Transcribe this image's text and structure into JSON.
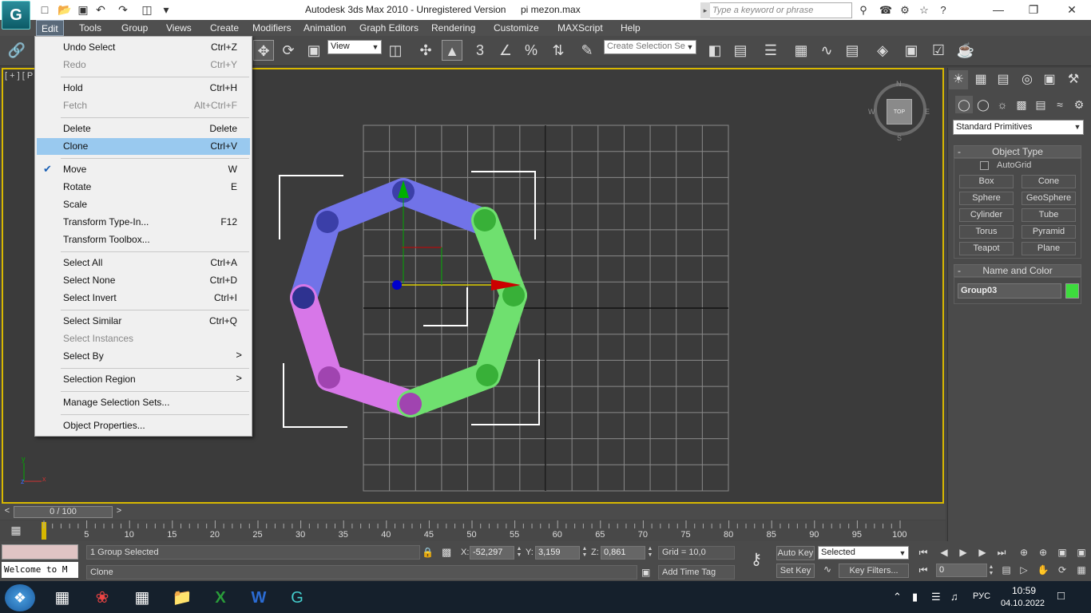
{
  "app": {
    "title": "Autodesk 3ds Max  2010  - Unregistered Version",
    "file": "pi mezon.max",
    "logo_icon": "3dsmax-logo-icon",
    "search_placeholder": "Type a keyword or phrase"
  },
  "menubar": [
    "Edit",
    "Tools",
    "Group",
    "Views",
    "Create",
    "Modifiers",
    "Animation",
    "Graph Editors",
    "Rendering",
    "Customize",
    "MAXScript",
    "Help"
  ],
  "edit_menu": {
    "items": [
      {
        "label": "Undo Select",
        "shortcut": "Ctrl+Z",
        "disabled": false
      },
      {
        "label": "Redo",
        "shortcut": "Ctrl+Y",
        "disabled": true
      },
      {
        "sep": true
      },
      {
        "label": "Hold",
        "shortcut": "Ctrl+H",
        "disabled": false
      },
      {
        "label": "Fetch",
        "shortcut": "Alt+Ctrl+F",
        "disabled": true
      },
      {
        "sep": true
      },
      {
        "label": "Delete",
        "shortcut": "Delete",
        "disabled": false
      },
      {
        "label": "Clone",
        "shortcut": "Ctrl+V",
        "disabled": false,
        "highlighted": true
      },
      {
        "sep": true
      },
      {
        "label": "Move",
        "shortcut": "W",
        "disabled": false,
        "checked": true
      },
      {
        "label": "Rotate",
        "shortcut": "E",
        "disabled": false
      },
      {
        "label": "Scale",
        "shortcut": "",
        "disabled": false
      },
      {
        "label": "Transform Type-In...",
        "shortcut": "F12",
        "disabled": false
      },
      {
        "label": "Transform Toolbox...",
        "shortcut": "",
        "disabled": false
      },
      {
        "sep": true
      },
      {
        "label": "Select All",
        "shortcut": "Ctrl+A",
        "disabled": false
      },
      {
        "label": "Select None",
        "shortcut": "Ctrl+D",
        "disabled": false
      },
      {
        "label": "Select Invert",
        "shortcut": "Ctrl+I",
        "disabled": false
      },
      {
        "sep": true
      },
      {
        "label": "Select Similar",
        "shortcut": "Ctrl+Q",
        "disabled": false
      },
      {
        "label": "Select Instances",
        "shortcut": "",
        "disabled": true
      },
      {
        "label": "Select By",
        "shortcut": "",
        "disabled": false,
        "submenu": true
      },
      {
        "sep": true
      },
      {
        "label": "Selection Region",
        "shortcut": "",
        "disabled": false,
        "submenu": true
      },
      {
        "sep": true
      },
      {
        "label": "Manage Selection Sets...",
        "shortcut": "",
        "disabled": false
      },
      {
        "sep": true
      },
      {
        "label": "Object Properties...",
        "shortcut": "",
        "disabled": false
      }
    ],
    "submenu_glyph": ">"
  },
  "toolbar": {
    "ref_coord": "View",
    "selection_set_placeholder": "Create Selection Se",
    "snap_label": "3",
    "snap_label_angle": "%"
  },
  "viewport": {
    "label": "[ + ] [ P",
    "navcube_label": "TOP",
    "navcube_letters": [
      "N",
      "W",
      "S",
      "E"
    ],
    "ring_colors": {
      "blue": "#7173e8",
      "blue_dark": "#3b3fa8",
      "green": "#6fe06f",
      "green_dark": "#38b038",
      "magenta": "#d777e8",
      "magenta_dark": "#a044b0"
    },
    "mini_axis": {
      "y": "y",
      "x": "x",
      "z": "z"
    }
  },
  "timeline": {
    "slider_label": "0 / 100",
    "prev": "<",
    "next": ">",
    "ticks": [
      "5",
      "10",
      "15",
      "20",
      "25",
      "30",
      "35",
      "40",
      "45",
      "50",
      "55",
      "60",
      "65",
      "70",
      "75",
      "80",
      "85",
      "90",
      "95",
      "100"
    ]
  },
  "status": {
    "selection": "1 Group Selected",
    "prompt": "Clone",
    "macro_text": "Welcome to M",
    "x_label": "X:",
    "x_value": "-52,297",
    "y_label": "Y:",
    "y_value": "3,159",
    "z_label": "Z:",
    "z_value": "0,861",
    "grid": "Grid = 10,0",
    "add_time_tag": "Add Time Tag",
    "auto_key": "Auto Key",
    "set_key": "Set Key",
    "selected_dd": "Selected",
    "key_filters": "Key Filters...",
    "frame_value": "0"
  },
  "command_panel": {
    "primitives_dd": "Standard Primitives",
    "object_type_title": "Object Type",
    "autogrid_label": "AutoGrid",
    "buttons": [
      "Box",
      "Cone",
      "Sphere",
      "GeoSphere",
      "Cylinder",
      "Tube",
      "Torus",
      "Pyramid",
      "Teapot",
      "Plane"
    ],
    "name_color_title": "Name and Color",
    "object_name": "Group03",
    "object_color": "#3ddc3d",
    "rollout_minus": "-"
  },
  "taskbar": {
    "time": "10:59",
    "date": "04.10.2022",
    "lang": "РУС",
    "apps": [
      "task-view-icon",
      "paint-icon",
      "calculator-icon",
      "file-explorer-icon",
      "excel-icon",
      "word-icon",
      "3dsmax-icon"
    ]
  }
}
